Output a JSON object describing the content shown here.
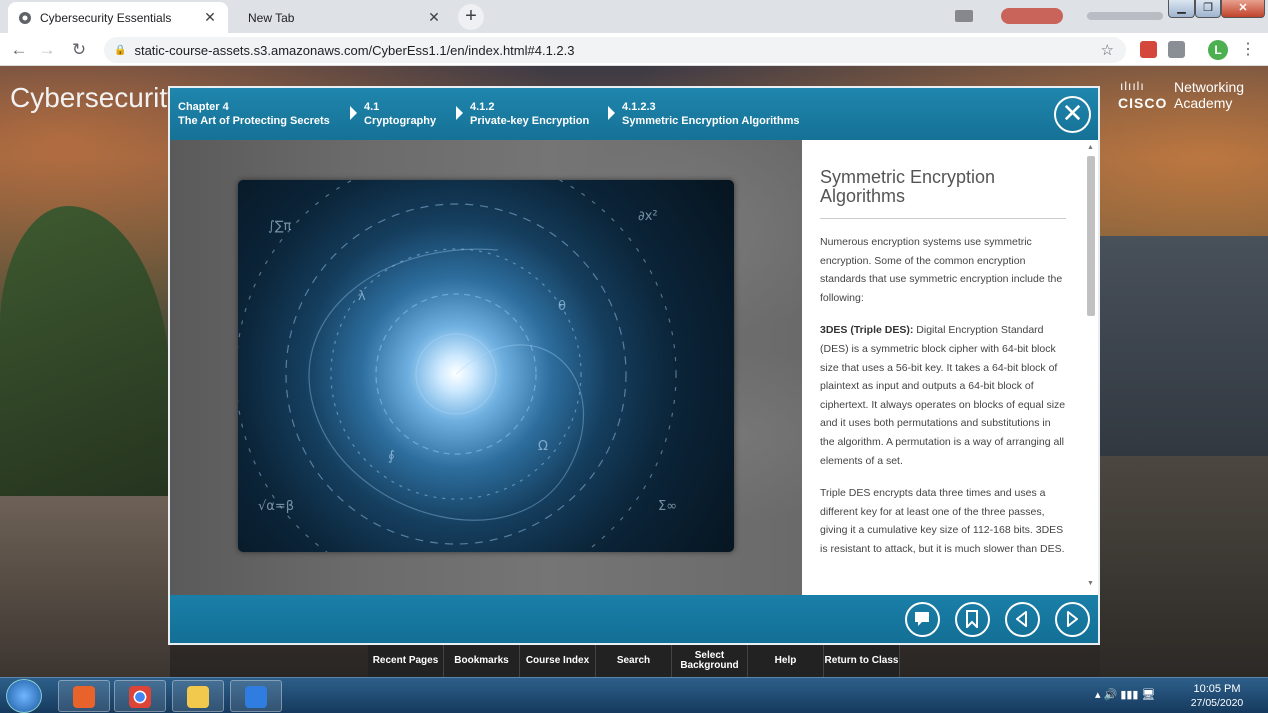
{
  "browser": {
    "tabs": [
      {
        "label": "Cybersecurity Essentials",
        "active": true
      },
      {
        "label": "New Tab",
        "active": false
      }
    ],
    "new_tab": "+",
    "url": "static-course-assets.s3.amazonaws.com/CyberEss1.1/en/index.html#4.1.2.3",
    "avatar_letter": "L"
  },
  "page": {
    "site_title": "Cybersecurity Essentials",
    "brand": {
      "logo_word": "CISCO",
      "line1": "Networking",
      "line2": "Academy"
    }
  },
  "breadcrumb": [
    {
      "num": "Chapter 4",
      "label": "The Art of Protecting Secrets"
    },
    {
      "num": "4.1",
      "label": "Cryptography"
    },
    {
      "num": "4.1.2",
      "label": "Private-key Encryption"
    },
    {
      "num": "4.1.2.3",
      "label": "Symmetric Encryption Algorithms"
    }
  ],
  "content": {
    "title": "Symmetric Encryption Algorithms",
    "intro": "Numerous encryption systems use symmetric encryption. Some of the common encryption standards that use symmetric encryption include the following:",
    "des_term": "3DES (Triple DES):",
    "des_text": "Digital Encryption Standard (DES) is a symmetric block cipher with 64-bit block size that uses a 56-bit key. It takes a 64-bit block of plaintext as input and outputs a 64-bit block of ciphertext. It always operates on blocks of equal size and it uses both permutations and substitutions in the algorithm. A permutation is a way of arranging all elements of a set.",
    "triple": "Triple DES encrypts data three times and uses a different key for at least one of the three passes, giving it a cumulative key size of 112-168 bits. 3DES is resistant to attack, but it is much slower than DES."
  },
  "bottom_nav": [
    {
      "label": "Recent Pages"
    },
    {
      "label": "Bookmarks"
    },
    {
      "label": "Course Index"
    },
    {
      "label": "Search"
    },
    {
      "label": "Select Background"
    },
    {
      "label": "Help"
    },
    {
      "label": "Return to Class"
    }
  ],
  "taskbar": {
    "time": "10:05 PM",
    "date": "27/05/2020"
  },
  "colors": {
    "teal": "#1a7fa8",
    "accent": "#2a8fc4"
  }
}
